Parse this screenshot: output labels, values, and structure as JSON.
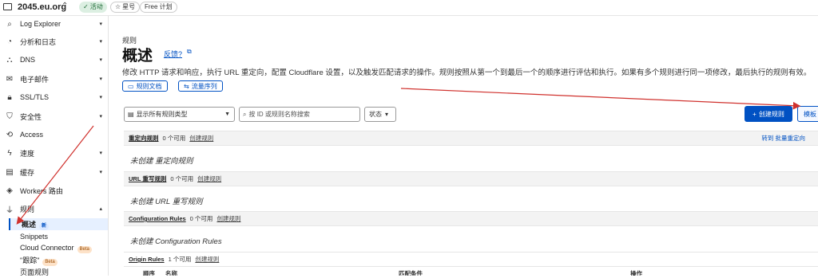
{
  "topbar": {
    "account_name": "2045.eu.org",
    "switch_icon": "chevron-updown-icon",
    "status_badge": "活动",
    "star_badge": "星号",
    "plan_badge": "Free 计划"
  },
  "sidebar": {
    "items": [
      {
        "label": "Log Explorer",
        "icon": "search-doc-icon",
        "caret": "▾"
      },
      {
        "label": "分析和日志",
        "icon": "chart-icon",
        "caret": "▾"
      },
      {
        "label": "DNS",
        "icon": "network-icon",
        "caret": "▾"
      },
      {
        "label": "电子邮件",
        "icon": "mail-icon",
        "caret": "▾"
      },
      {
        "label": "SSL/TLS",
        "icon": "lock-icon",
        "caret": "▾"
      },
      {
        "label": "安全性",
        "icon": "shield-icon",
        "caret": "▾"
      },
      {
        "label": "Access",
        "icon": "access-icon",
        "caret": ""
      },
      {
        "label": "速度",
        "icon": "bolt-icon",
        "caret": "▾"
      },
      {
        "label": "缓存",
        "icon": "cache-icon",
        "caret": "▾"
      },
      {
        "label": "Workers 路由",
        "icon": "workers-icon",
        "caret": ""
      },
      {
        "label": "规则",
        "icon": "funnel-icon",
        "caret": "▴"
      }
    ],
    "sub_items": [
      {
        "label": "概述",
        "badge": "新"
      },
      {
        "label": "Snippets",
        "badge": ""
      },
      {
        "label": "Cloud Connector",
        "badge": "Beta"
      },
      {
        "label": "\"跟踪\"",
        "badge": "Beta"
      },
      {
        "label": "页面规则",
        "badge": ""
      }
    ]
  },
  "main": {
    "breadcrumb": "规则",
    "title": "概述",
    "feedback_link": "反馈?",
    "description": "修改 HTTP 请求和响应，执行 URL 重定向，配置 Cloudflare 设置，以及触发匹配请求的操作。规则按照从第一个到最后一个的顺序进行评估和执行。如果有多个规则进行同一项修改，最后执行的规则有效。",
    "docs_button": "规则文档",
    "flow_button": "流量序列",
    "filter_select": "显示所有规则类型",
    "search_placeholder": "按 ID 或规则名称搜索",
    "status_button": "状态",
    "create_button": "创建规则",
    "template_button": "模板",
    "sections": [
      {
        "name": "重定向规则",
        "count": "0 个可用",
        "create": "创建规则",
        "right": "转到 批量重定向",
        "empty": "未创建 重定向规则"
      },
      {
        "name": "URL 重写规则",
        "count": "0 个可用",
        "create": "创建规则",
        "right": "",
        "empty": "未创建 URL 重写规则"
      },
      {
        "name": "Configuration Rules",
        "count": "0 个可用",
        "create": "创建规则",
        "right": "",
        "empty": "未创建 Configuration Rules"
      },
      {
        "name": "Origin Rules",
        "count": "1 个可用",
        "create": "创建规则",
        "right": "",
        "empty": ""
      }
    ],
    "table_headers": [
      "顺序",
      "名称",
      "匹配条件",
      "操作"
    ]
  },
  "colors": {
    "accent": "#0051c3",
    "annotation_arrow": "#d0312d"
  }
}
